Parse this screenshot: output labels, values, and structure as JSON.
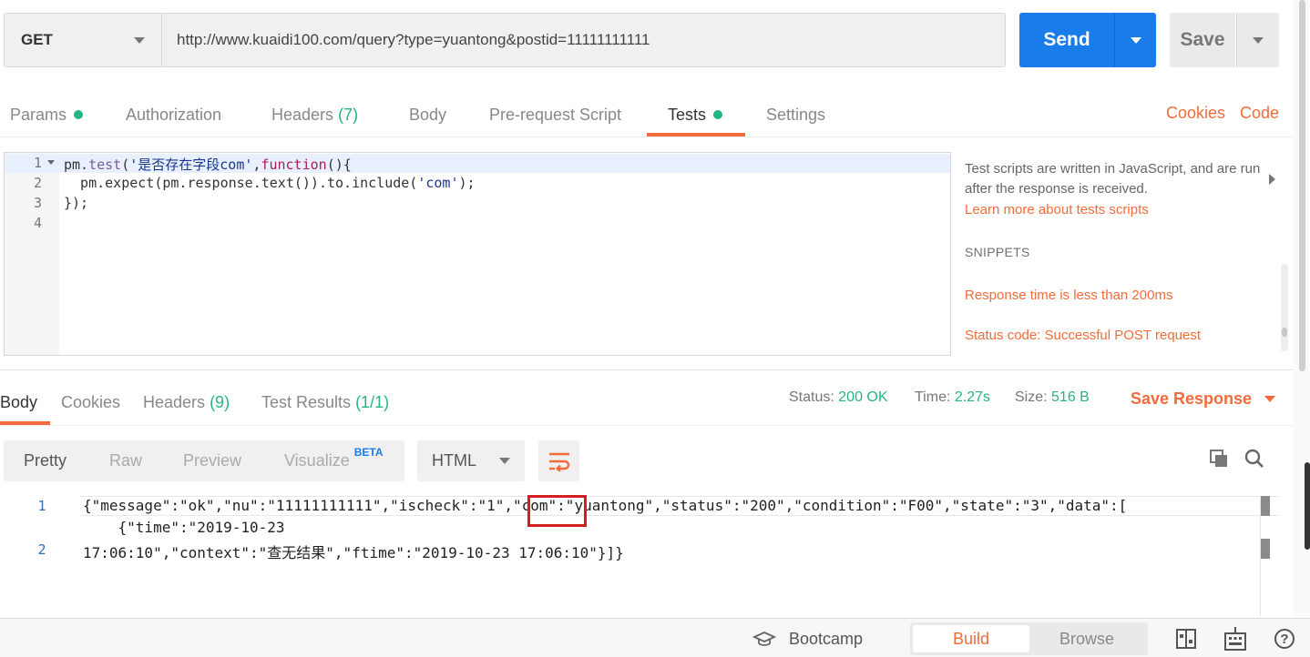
{
  "request": {
    "method": "GET",
    "url": "http://www.kuaidi100.com/query?type=yuantong&postid=11111111111",
    "send_label": "Send",
    "save_label": "Save"
  },
  "request_tabs": {
    "params": "Params",
    "authorization": "Authorization",
    "headers": "Headers",
    "headers_count": "(7)",
    "body": "Body",
    "prerequest": "Pre-request Script",
    "tests": "Tests",
    "settings": "Settings",
    "cookies": "Cookies",
    "code": "Code"
  },
  "editor": {
    "line_numbers": [
      "1",
      "2",
      "3",
      "4"
    ],
    "line1": {
      "a": "pm.",
      "fn": "test",
      "b": "(",
      "str": "'是否存在字段com'",
      "c": ",",
      "kw": "function",
      "d": "(){"
    },
    "line2": {
      "a": "  pm.expect(pm.response.text()).to.include(",
      "str": "'com'",
      "b": ");"
    },
    "line3": "});"
  },
  "help_panel": {
    "text": "Test scripts are written in JavaScript, and are run after the response is received.",
    "link": "Learn more about tests scripts",
    "snippets_heading": "SNIPPETS",
    "snippets": [
      "Response time is less than 200ms",
      "Status code: Successful POST request"
    ]
  },
  "response_tabs": {
    "body": "Body",
    "cookies": "Cookies",
    "headers": "Headers",
    "headers_count": "(9)",
    "test_results": "Test Results",
    "test_results_count": "(1/1)"
  },
  "response_meta": {
    "status_label": "Status:",
    "status_value": "200 OK",
    "time_label": "Time:",
    "time_value": "2.27s",
    "size_label": "Size:",
    "size_value": "516 B",
    "save_response": "Save Response"
  },
  "body_view": {
    "pretty": "Pretty",
    "raw": "Raw",
    "preview": "Preview",
    "visualize": "Visualize",
    "beta": "BETA",
    "format": "HTML"
  },
  "response_body": {
    "line_numbers": [
      "1",
      "2"
    ],
    "line1": "{\"message\":\"ok\",\"nu\":\"11111111111\",\"ischeck\":\"1\",\"com\":\"yuantong\",\"status\":\"200\",\"condition\":\"F00\",\"state\":\"3\",\"data\":[",
    "line1_cont": "    {\"time\":\"2019-10-23",
    "line2": "17:06:10\",\"context\":\"查无结果\",\"ftime\":\"2019-10-23 17:06:10\"}]}"
  },
  "footer": {
    "bootcamp": "Bootcamp",
    "build": "Build",
    "browse": "Browse"
  },
  "colors": {
    "accent": "#f26b3a",
    "send_blue": "#1a7bea",
    "success_green": "#26b47f",
    "highlight_red": "#d41f1f"
  }
}
